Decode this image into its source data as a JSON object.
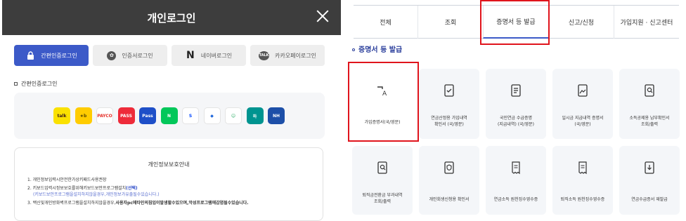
{
  "login": {
    "title": "개인로그인",
    "tabs": [
      {
        "label": "간편인증로그인",
        "icon": "lock-icon"
      },
      {
        "label": "인증서로그인",
        "icon": "certificate-icon"
      },
      {
        "label": "네이버로그인",
        "icon": "naver-icon",
        "glyph": "N"
      },
      {
        "label": "카카오페이로그인",
        "icon": "kakaotalk-icon",
        "glyph": "TALK"
      }
    ],
    "cert_heading": "간편인증로그인",
    "providers": [
      {
        "name": "kakao",
        "glyph": "talk",
        "bg": "#fae100",
        "fg": "#3b1e1e"
      },
      {
        "name": "kb",
        "glyph": "★b",
        "bg": "#ffcc00",
        "fg": "#5c4a00"
      },
      {
        "name": "payco",
        "glyph": "PAYCO",
        "bg": "#ffffff",
        "fg": "#e5322b"
      },
      {
        "name": "pass-red",
        "glyph": "PASS",
        "bg": "#ee2b3a",
        "fg": "#ffffff"
      },
      {
        "name": "pass-blue",
        "glyph": "Pass",
        "bg": "#1e4fc8",
        "fg": "#ffffff"
      },
      {
        "name": "naver",
        "glyph": "N",
        "bg": "#03c75a",
        "fg": "#ffffff"
      },
      {
        "name": "shinhan",
        "glyph": "S",
        "bg": "#ffffff",
        "fg": "#0046ff"
      },
      {
        "name": "toss",
        "glyph": "◆",
        "bg": "#ffffff",
        "fg": "#1b64da"
      },
      {
        "name": "samsung",
        "glyph": "☺",
        "bg": "#ffffff",
        "fg": "#2fae68"
      },
      {
        "name": "hana",
        "glyph": "하",
        "bg": "#009490",
        "fg": "#ffffff"
      },
      {
        "name": "nh",
        "glyph": "NH",
        "bg": "#1d4fa8",
        "fg": "#ffffff"
      }
    ],
    "privacy": {
      "title": "개인정보보호안내",
      "items": [
        {
          "num": "1.",
          "text": "개인정보입력시안전한가상키패드사용권장"
        },
        {
          "num": "2.",
          "text": "키보드입력시정보보호를위해키보드보안프로그램설치",
          "emph": "(선택)",
          "sub": "(키보드보안프로그램을설치하지않을경우,개인정보가유출될수있습니다.)"
        },
        {
          "num": "3.",
          "text": "백신및개인방화벽프로그램을설치하지않을경우,",
          "bold": "사용자pc에타인의침입이발생할수있으며,악성프로그램에감염될수있습니다."
        }
      ]
    }
  },
  "cert": {
    "tabs": [
      "전체",
      "조회",
      "증명서 등 발급",
      "신고/신청",
      "가입지원 · 신고센터"
    ],
    "active_tab": "증명서 등 발급",
    "section_title": "증명서 등 발급",
    "cards": [
      {
        "label": "가입증명서(국/영문)",
        "icon": "translate-icon"
      },
      {
        "label": "연금산정용 가입내역\n확인서 (국/영문)",
        "icon": "document-check-icon"
      },
      {
        "label": "국민연금 수급증명\n(지급내역) (국/영문)",
        "icon": "document-list-icon"
      },
      {
        "label": "일시금 지급내역 증명서\n(국/영문)",
        "icon": "document-image-icon"
      },
      {
        "label": "소득공제용 납부확인서\n조회/출력",
        "icon": "document-search-icon"
      },
      {
        "label": "퇴직금전환금 부과내역\n조회/출력",
        "icon": "document-search-icon"
      },
      {
        "label": "개인회생신청용 확인서",
        "icon": "document-shield-icon"
      },
      {
        "label": "연금소득 원천징수영수증",
        "icon": "receipt-icon"
      },
      {
        "label": "퇴직소득 원천징수영수증",
        "icon": "receipt-icon"
      },
      {
        "label": "연금수급증서 재발급",
        "icon": "document-download-icon"
      }
    ]
  },
  "colors": {
    "accent": "#3c5ac8",
    "header_bg": "#3d3d3d",
    "highlight": "#e0141c",
    "section_title": "#2b3f9c"
  }
}
